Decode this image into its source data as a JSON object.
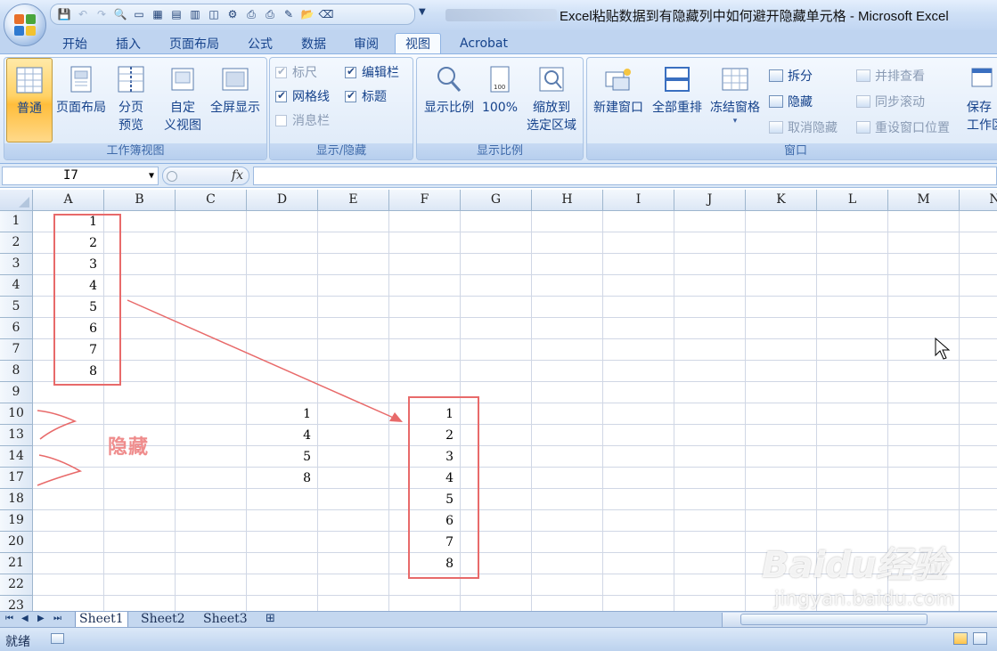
{
  "window": {
    "title": "Excel粘贴数据到有隐藏列中如何避开隐藏单元格 - Microsoft Excel"
  },
  "tabs": [
    {
      "label": "开始",
      "active": false
    },
    {
      "label": "插入",
      "active": false
    },
    {
      "label": "页面布局",
      "active": false
    },
    {
      "label": "公式",
      "active": false
    },
    {
      "label": "数据",
      "active": false
    },
    {
      "label": "审阅",
      "active": false
    },
    {
      "label": "视图",
      "active": true
    },
    {
      "label": "Acrobat",
      "active": false
    }
  ],
  "ribbon": {
    "workbook_views": {
      "label": "工作簿视图",
      "normal": "普通",
      "page_layout": "页面布局",
      "page_break": "分页\n预览",
      "custom_views": "自定\n义视图",
      "full_screen": "全屏显示"
    },
    "show_hide": {
      "label": "显示/隐藏",
      "ruler": "标尺",
      "formula_bar": "编辑栏",
      "gridlines": "网格线",
      "headings": "标题",
      "message_bar": "消息栏"
    },
    "zoom": {
      "label": "显示比例",
      "zoom": "显示比例",
      "hundred": "100%",
      "zoom_selection": "缩放到\n选定区域"
    },
    "window_group": {
      "label": "窗口",
      "new_window": "新建窗口",
      "arrange_all": "全部重排",
      "freeze_panes": "冻结窗格",
      "split": "拆分",
      "hide": "隐藏",
      "unhide": "取消隐藏",
      "side_by_side": "并排查看",
      "sync_scroll": "同步滚动",
      "reset_position": "重设窗口位置",
      "save_workspace": "保存\n工作区"
    }
  },
  "formula_bar": {
    "name_box": "I7",
    "fx_label": "fx",
    "formula": ""
  },
  "grid": {
    "columns": [
      "A",
      "B",
      "C",
      "D",
      "E",
      "F",
      "G",
      "H",
      "I",
      "J",
      "K",
      "L",
      "M",
      "N"
    ],
    "rows": [
      "1",
      "2",
      "3",
      "4",
      "5",
      "6",
      "7",
      "8",
      "9",
      "10",
      "13",
      "14",
      "17",
      "18",
      "19",
      "20",
      "21",
      "22",
      "23"
    ],
    "cells": [
      {
        "ref": "A1",
        "value": "1"
      },
      {
        "ref": "A2",
        "value": "2"
      },
      {
        "ref": "A3",
        "value": "3"
      },
      {
        "ref": "A4",
        "value": "4"
      },
      {
        "ref": "A5",
        "value": "5"
      },
      {
        "ref": "A6",
        "value": "6"
      },
      {
        "ref": "A7",
        "value": "7"
      },
      {
        "ref": "A8",
        "value": "8"
      },
      {
        "ref": "D10",
        "value": "1"
      },
      {
        "ref": "D13",
        "value": "4"
      },
      {
        "ref": "D14",
        "value": "5"
      },
      {
        "ref": "D17",
        "value": "8"
      },
      {
        "ref": "F10",
        "value": "1"
      },
      {
        "ref": "F13",
        "value": "2"
      },
      {
        "ref": "F14",
        "value": "3"
      },
      {
        "ref": "F17",
        "value": "4"
      },
      {
        "ref": "F18",
        "value": "5"
      },
      {
        "ref": "F19",
        "value": "6"
      },
      {
        "ref": "F20",
        "value": "7"
      },
      {
        "ref": "F21",
        "value": "8"
      }
    ],
    "annotation_text": "隐藏",
    "annotation_color": "#e86a6a"
  },
  "sheets": [
    {
      "name": "Sheet1",
      "active": true
    },
    {
      "name": "Sheet2",
      "active": false
    },
    {
      "name": "Sheet3",
      "active": false
    }
  ],
  "status": {
    "ready": "就绪"
  },
  "watermark": {
    "logo": "Baidu经验",
    "url": "jingyan.baidu.com"
  },
  "colors": {
    "ribbon_bg": "#dbe8f8",
    "accent": "#15428b",
    "annotation": "#e86a6a"
  }
}
